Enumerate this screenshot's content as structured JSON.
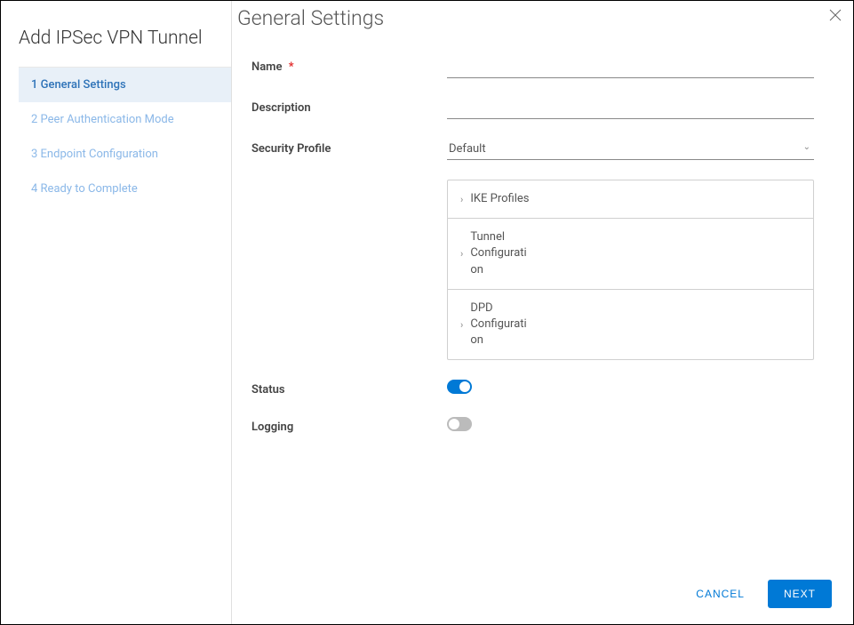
{
  "sidebar": {
    "title": "Add IPSec VPN Tunnel",
    "steps": [
      {
        "num": "1",
        "label": "General Settings",
        "active": true
      },
      {
        "num": "2",
        "label": "Peer Authentication Mode",
        "active": false
      },
      {
        "num": "3",
        "label": "Endpoint Configuration",
        "active": false
      },
      {
        "num": "4",
        "label": "Ready to Complete",
        "active": false
      }
    ]
  },
  "main": {
    "title": "General Settings",
    "fields": {
      "name_label": "Name",
      "name_value": "",
      "description_label": "Description",
      "description_value": "",
      "security_profile_label": "Security Profile",
      "security_profile_value": "Default",
      "status_label": "Status",
      "status_on": true,
      "logging_label": "Logging",
      "logging_on": false
    },
    "accordion": [
      {
        "label": "IKE Profiles"
      },
      {
        "label": "Tunnel Configuration"
      },
      {
        "label": "DPD Configuration"
      }
    ]
  },
  "footer": {
    "cancel_label": "CANCEL",
    "next_label": "NEXT"
  }
}
